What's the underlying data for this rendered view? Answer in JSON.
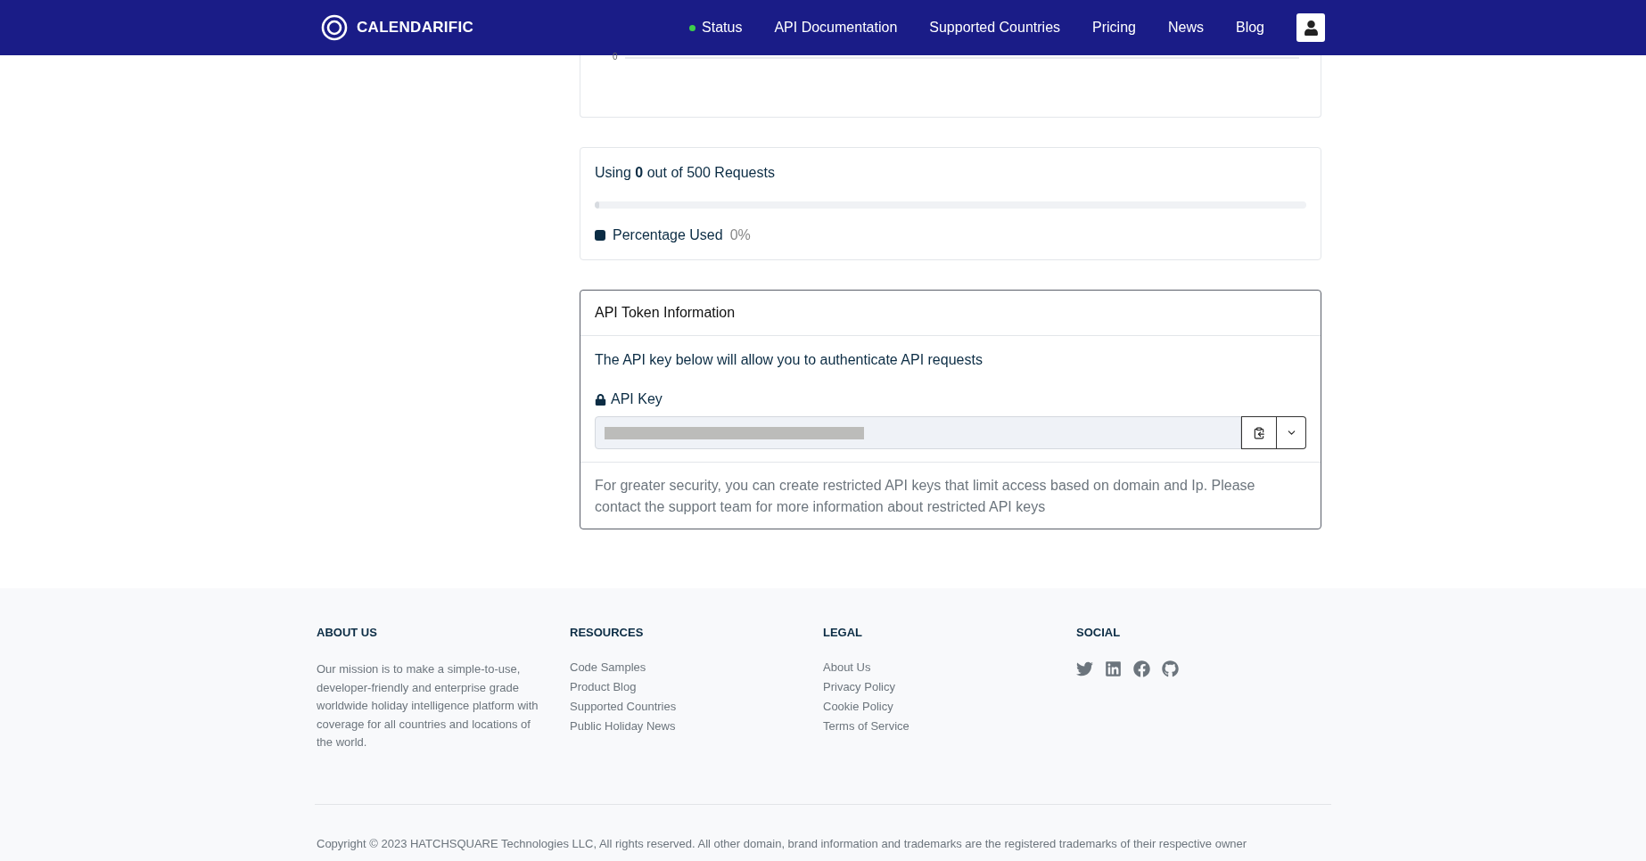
{
  "navbar": {
    "logo": "CALENDARIFIC",
    "links": [
      {
        "label": "Status",
        "kind": "status",
        "color": "#3ecf4c"
      },
      {
        "label": "API Documentation",
        "kind": "link"
      },
      {
        "label": "Supported Countries",
        "kind": "link"
      },
      {
        "label": "Pricing",
        "kind": "link"
      },
      {
        "label": "News",
        "kind": "link"
      },
      {
        "label": "Blog",
        "kind": "link"
      }
    ]
  },
  "chart": {
    "axis_label": "0"
  },
  "usage": {
    "text": "Using **0** out of 500 Requests",
    "level": 0,
    "legend": {
      "label": "Percentage Used",
      "value": "0%",
      "color": "#0b2c44"
    }
  },
  "token": {
    "title": "API Token Information",
    "description": "The API key below will allow you to authenticate API requests",
    "key_label": "API Key",
    "note": "For greater security, you can create restricted API keys that limit access based on domain and Ip. Please contact the support team for more information about restricted API keys"
  },
  "footer": {
    "columns": [
      {
        "kind": "text",
        "heading": "ABOUT US",
        "text": "Our mission is to make a simple-to-use, developer-friendly and enterprise grade worldwide holiday intelligence platform with coverage for all countries and locations of the world."
      },
      {
        "kind": "links",
        "heading": "RESOURCES",
        "links": [
          "Code Samples",
          "Product Blog",
          "Supported Countries",
          "Public Holiday News"
        ]
      },
      {
        "kind": "links",
        "heading": "LEGAL",
        "links": [
          "About Us",
          "Privacy Policy",
          "Cookie Policy",
          "Terms of Service"
        ]
      },
      {
        "kind": "social",
        "heading": "SOCIAL"
      }
    ],
    "copyright": "Copyright © 2023 HATCHSQUARE Technologies LLC, All rights reserved. All other domain, brand information and trademarks are the registered trademarks of their respective owner"
  }
}
